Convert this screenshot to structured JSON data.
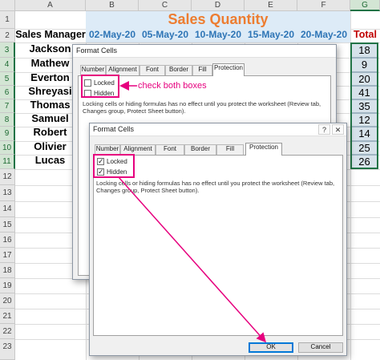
{
  "sheet": {
    "columns": [
      "A",
      "B",
      "C",
      "D",
      "E",
      "F",
      "G"
    ],
    "rows": [
      "1",
      "2",
      "3",
      "4",
      "5",
      "6",
      "7",
      "8",
      "9",
      "10",
      "11",
      "12",
      "13",
      "14",
      "15",
      "16",
      "17",
      "18",
      "19",
      "20",
      "21",
      "22",
      "23"
    ],
    "title": "Sales Quantity",
    "headers": {
      "manager": "Sales Manager",
      "dates": [
        "02-May-20",
        "05-May-20",
        "10-May-20",
        "15-May-20",
        "20-May-20"
      ],
      "total": "Total"
    },
    "managers": [
      "Jackson",
      "Mathew",
      "Everton",
      "Shreyasi",
      "Thomas",
      "Samuel",
      "Robert",
      "Olivier",
      "Lucas"
    ],
    "totals": [
      "18",
      "9",
      "20",
      "41",
      "35",
      "12",
      "14",
      "25",
      "26"
    ],
    "colors": {
      "title": "#ed7d31",
      "header_date": "#2e75b6",
      "total_header": "#c00000",
      "header_fill": "#ddebf7",
      "selection": "#217346"
    }
  },
  "dialog_back": {
    "title": "Format Cells",
    "tabs": [
      "Number",
      "Alignment",
      "Font",
      "Border",
      "Fill",
      "Protection"
    ],
    "active_tab": "Protection",
    "locked_label": "Locked",
    "hidden_label": "Hidden",
    "locked_checked": false,
    "hidden_checked": false,
    "note": "Locking cells or hiding formulas has no effect until you protect the worksheet (Review tab, Changes group, Protect Sheet button)."
  },
  "dialog_front": {
    "title": "Format Cells",
    "help": "?",
    "close": "✕",
    "tabs": [
      "Number",
      "Alignment",
      "Font",
      "Border",
      "Fill",
      "Protection"
    ],
    "active_tab": "Protection",
    "locked_label": "Locked",
    "hidden_label": "Hidden",
    "locked_checked": true,
    "hidden_checked": true,
    "check_glyph": "✓",
    "note": "Locking cells or hiding formulas has no effect until you protect the worksheet (Review tab, Changes group, Protect Sheet button).",
    "ok_label": "OK",
    "cancel_label": "Cancel"
  },
  "annotation": {
    "text": "check both boxes",
    "color": "#e6007e"
  }
}
